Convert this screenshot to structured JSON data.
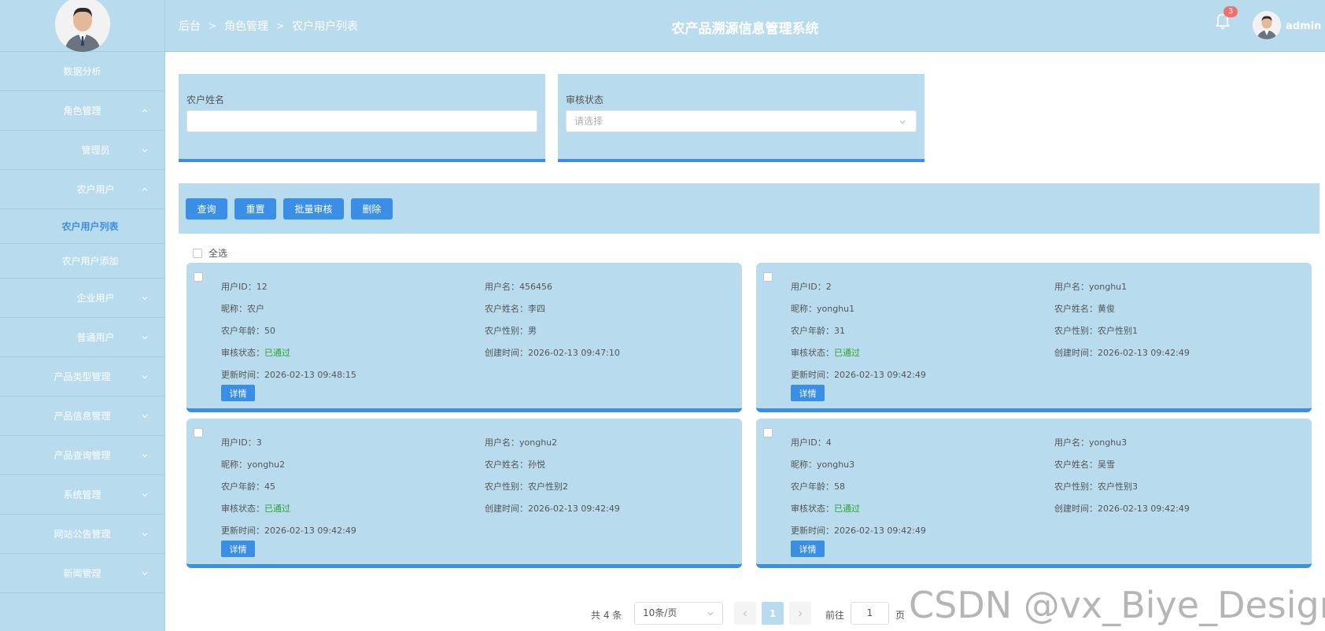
{
  "sidebar": {
    "items": [
      {
        "label": "数据分析",
        "chevron": ""
      },
      {
        "label": "角色管理",
        "chevron": "up"
      },
      {
        "label": "管理员",
        "chevron": "down"
      },
      {
        "label": "农户用户",
        "chevron": "up"
      },
      {
        "label": "农户用户列表",
        "chevron": ""
      },
      {
        "label": "农户用户添加",
        "chevron": ""
      },
      {
        "label": "企业用户",
        "chevron": "down"
      },
      {
        "label": "普通用户",
        "chevron": "down"
      },
      {
        "label": "产品类型管理",
        "chevron": "down"
      },
      {
        "label": "产品信息管理",
        "chevron": "down"
      },
      {
        "label": "产品查询管理",
        "chevron": "down"
      },
      {
        "label": "系统管理",
        "chevron": "down"
      },
      {
        "label": "网站公告管理",
        "chevron": "down"
      },
      {
        "label": "新闻管理",
        "chevron": "down"
      }
    ]
  },
  "header": {
    "breadcrumb": [
      "后台",
      "角色管理",
      "农户用户列表"
    ],
    "title": "农产品溯源信息管理系统",
    "notification_count": "3",
    "username": "admin"
  },
  "search": {
    "name_label": "农户姓名",
    "name_value": "",
    "status_label": "审核状态",
    "status_placeholder": "请选择"
  },
  "toolbar": {
    "query": "查询",
    "reset": "重置",
    "batch_review": "批量审核",
    "delete": "删除"
  },
  "select_all_label": "全选",
  "labels": {
    "user_id": "用户ID：",
    "username": "用户名：",
    "nickname": "昵称：",
    "farmer_name": "农户姓名：",
    "farmer_age": "农户年龄：",
    "farmer_gender": "农户性别：",
    "review_status": "审核状态：",
    "create_time": "创建时间：",
    "update_time": "更新时间：",
    "detail": "详情"
  },
  "cards": [
    {
      "user_id": "12",
      "username": "456456",
      "nickname": "农户",
      "farmer_name": "李四",
      "age": "50",
      "gender": "男",
      "status": "已通过",
      "created": "2026-02-13 09:47:10",
      "updated": "2026-02-13 09:48:15"
    },
    {
      "user_id": "2",
      "username": "yonghu1",
      "nickname": "yonghu1",
      "farmer_name": "黄俊",
      "age": "31",
      "gender": "农户性别1",
      "status": "已通过",
      "created": "2026-02-13 09:42:49",
      "updated": "2026-02-13 09:42:49"
    },
    {
      "user_id": "3",
      "username": "yonghu2",
      "nickname": "yonghu2",
      "farmer_name": "孙悦",
      "age": "45",
      "gender": "农户性别2",
      "status": "已通过",
      "created": "2026-02-13 09:42:49",
      "updated": "2026-02-13 09:42:49"
    },
    {
      "user_id": "4",
      "username": "yonghu3",
      "nickname": "yonghu3",
      "farmer_name": "吴雪",
      "age": "58",
      "gender": "农户性别3",
      "status": "已通过",
      "created": "2026-02-13 09:42:49",
      "updated": "2026-02-13 09:42:49"
    }
  ],
  "pagination": {
    "total": "共 4 条",
    "page_size": "10条/页",
    "current_page": "1",
    "goto_label": "前往",
    "goto_value": "1",
    "page_suffix": "页"
  },
  "watermark": "CSDN @vx_Biye_Design",
  "colors": {
    "panel": "#b8dcee",
    "accent": "#3b8ee6",
    "success": "#2aa52a",
    "badge": "#f56c6c"
  }
}
